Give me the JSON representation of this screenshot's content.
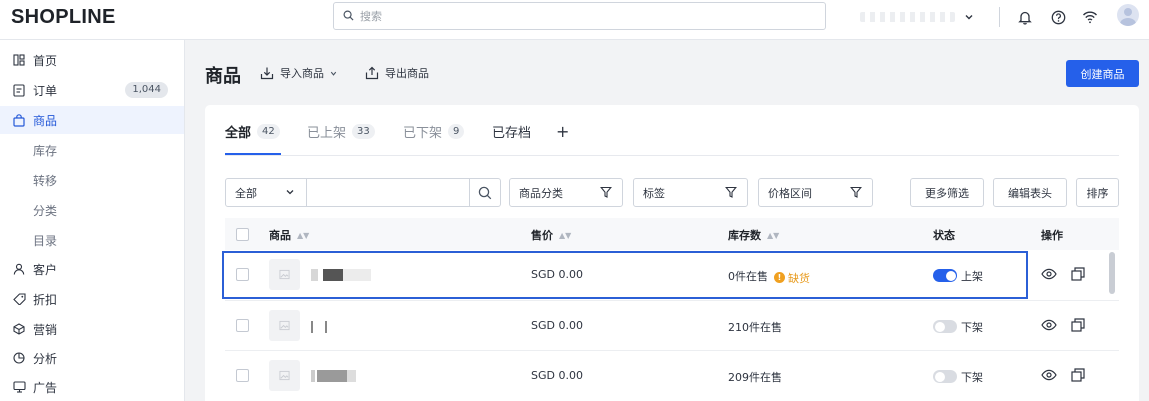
{
  "brand": {
    "logo": "SHOPLINE"
  },
  "search": {
    "placeholder": "搜索"
  },
  "sidebar": {
    "items": [
      {
        "label": "首页",
        "icon": "home-grid-icon"
      },
      {
        "label": "订单",
        "icon": "order-icon",
        "badge": "1,044"
      },
      {
        "label": "商品",
        "icon": "bag-icon",
        "active": true
      },
      {
        "label": "库存",
        "sub": true
      },
      {
        "label": "转移",
        "sub": true
      },
      {
        "label": "分类",
        "sub": true
      },
      {
        "label": "目录",
        "sub": true
      },
      {
        "label": "客户",
        "icon": "user-icon"
      },
      {
        "label": "折扣",
        "icon": "tag-icon"
      },
      {
        "label": "营销",
        "icon": "marketing-icon"
      },
      {
        "label": "分析",
        "icon": "chart-icon"
      },
      {
        "label": "广告",
        "icon": "ads-icon"
      }
    ]
  },
  "header": {
    "title": "商品",
    "import_label": "导入商品",
    "export_label": "导出商品",
    "create_label": "创建商品"
  },
  "tabs": [
    {
      "label": "全部",
      "count": "42",
      "active": true
    },
    {
      "label": "已上架",
      "count": "33"
    },
    {
      "label": "已下架",
      "count": "9"
    },
    {
      "label": "已存档",
      "count": ""
    }
  ],
  "filters": {
    "scope_value": "全部",
    "category_label": "商品分类",
    "tag_label": "标签",
    "price_label": "价格区间",
    "more_label": "更多筛选",
    "edit_columns_label": "编辑表头",
    "sort_label": "排序"
  },
  "table": {
    "columns": {
      "product": "商品",
      "price": "售价",
      "stock": "库存数",
      "status": "状态",
      "actions": "操作"
    },
    "rows": [
      {
        "price": "SGD 0.00",
        "stock": "0件在售",
        "warning": "缺货",
        "status": "上架",
        "on": true
      },
      {
        "price": "SGD 0.00",
        "stock": "210件在售",
        "warning": "",
        "status": "下架",
        "on": false
      },
      {
        "price": "SGD 0.00",
        "stock": "209件在售",
        "warning": "",
        "status": "下架",
        "on": false
      }
    ]
  },
  "colors": {
    "accent": "#2560ea",
    "warning": "#f0a020",
    "active_bg": "#eef3fe"
  }
}
